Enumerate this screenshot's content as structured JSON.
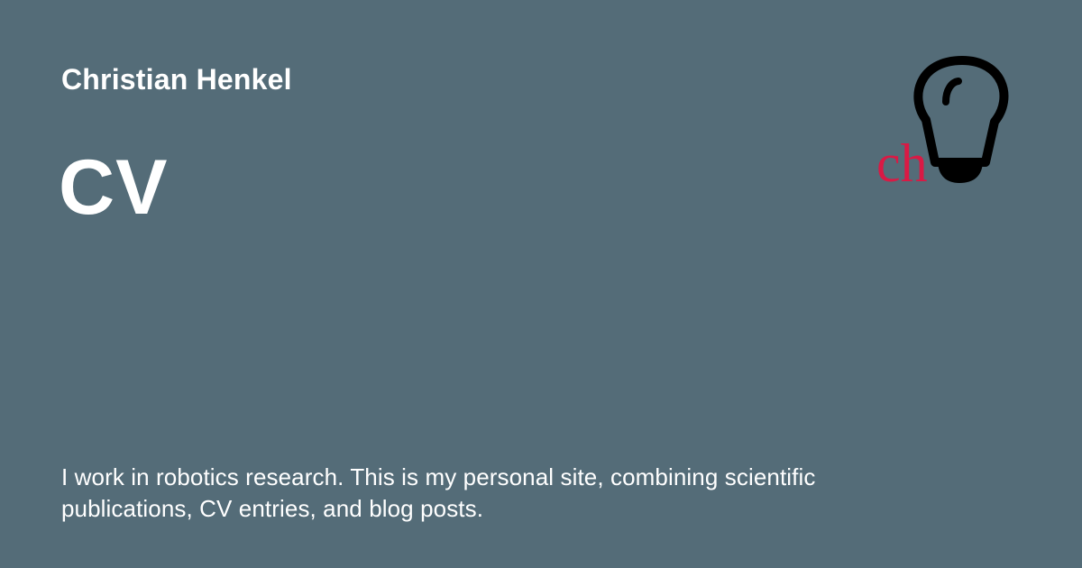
{
  "site": {
    "author_name": "Christian Henkel",
    "page_title": "CV",
    "description": "I work in robotics research. This is my personal site, combining scientific publications, CV entries, and blog posts."
  },
  "logo": {
    "monogram": "ch",
    "icon": "lightbulb-icon",
    "monogram_color": "#d91a45",
    "bulb_color": "#000000"
  },
  "colors": {
    "background": "#546c78",
    "text": "#ffffff"
  }
}
